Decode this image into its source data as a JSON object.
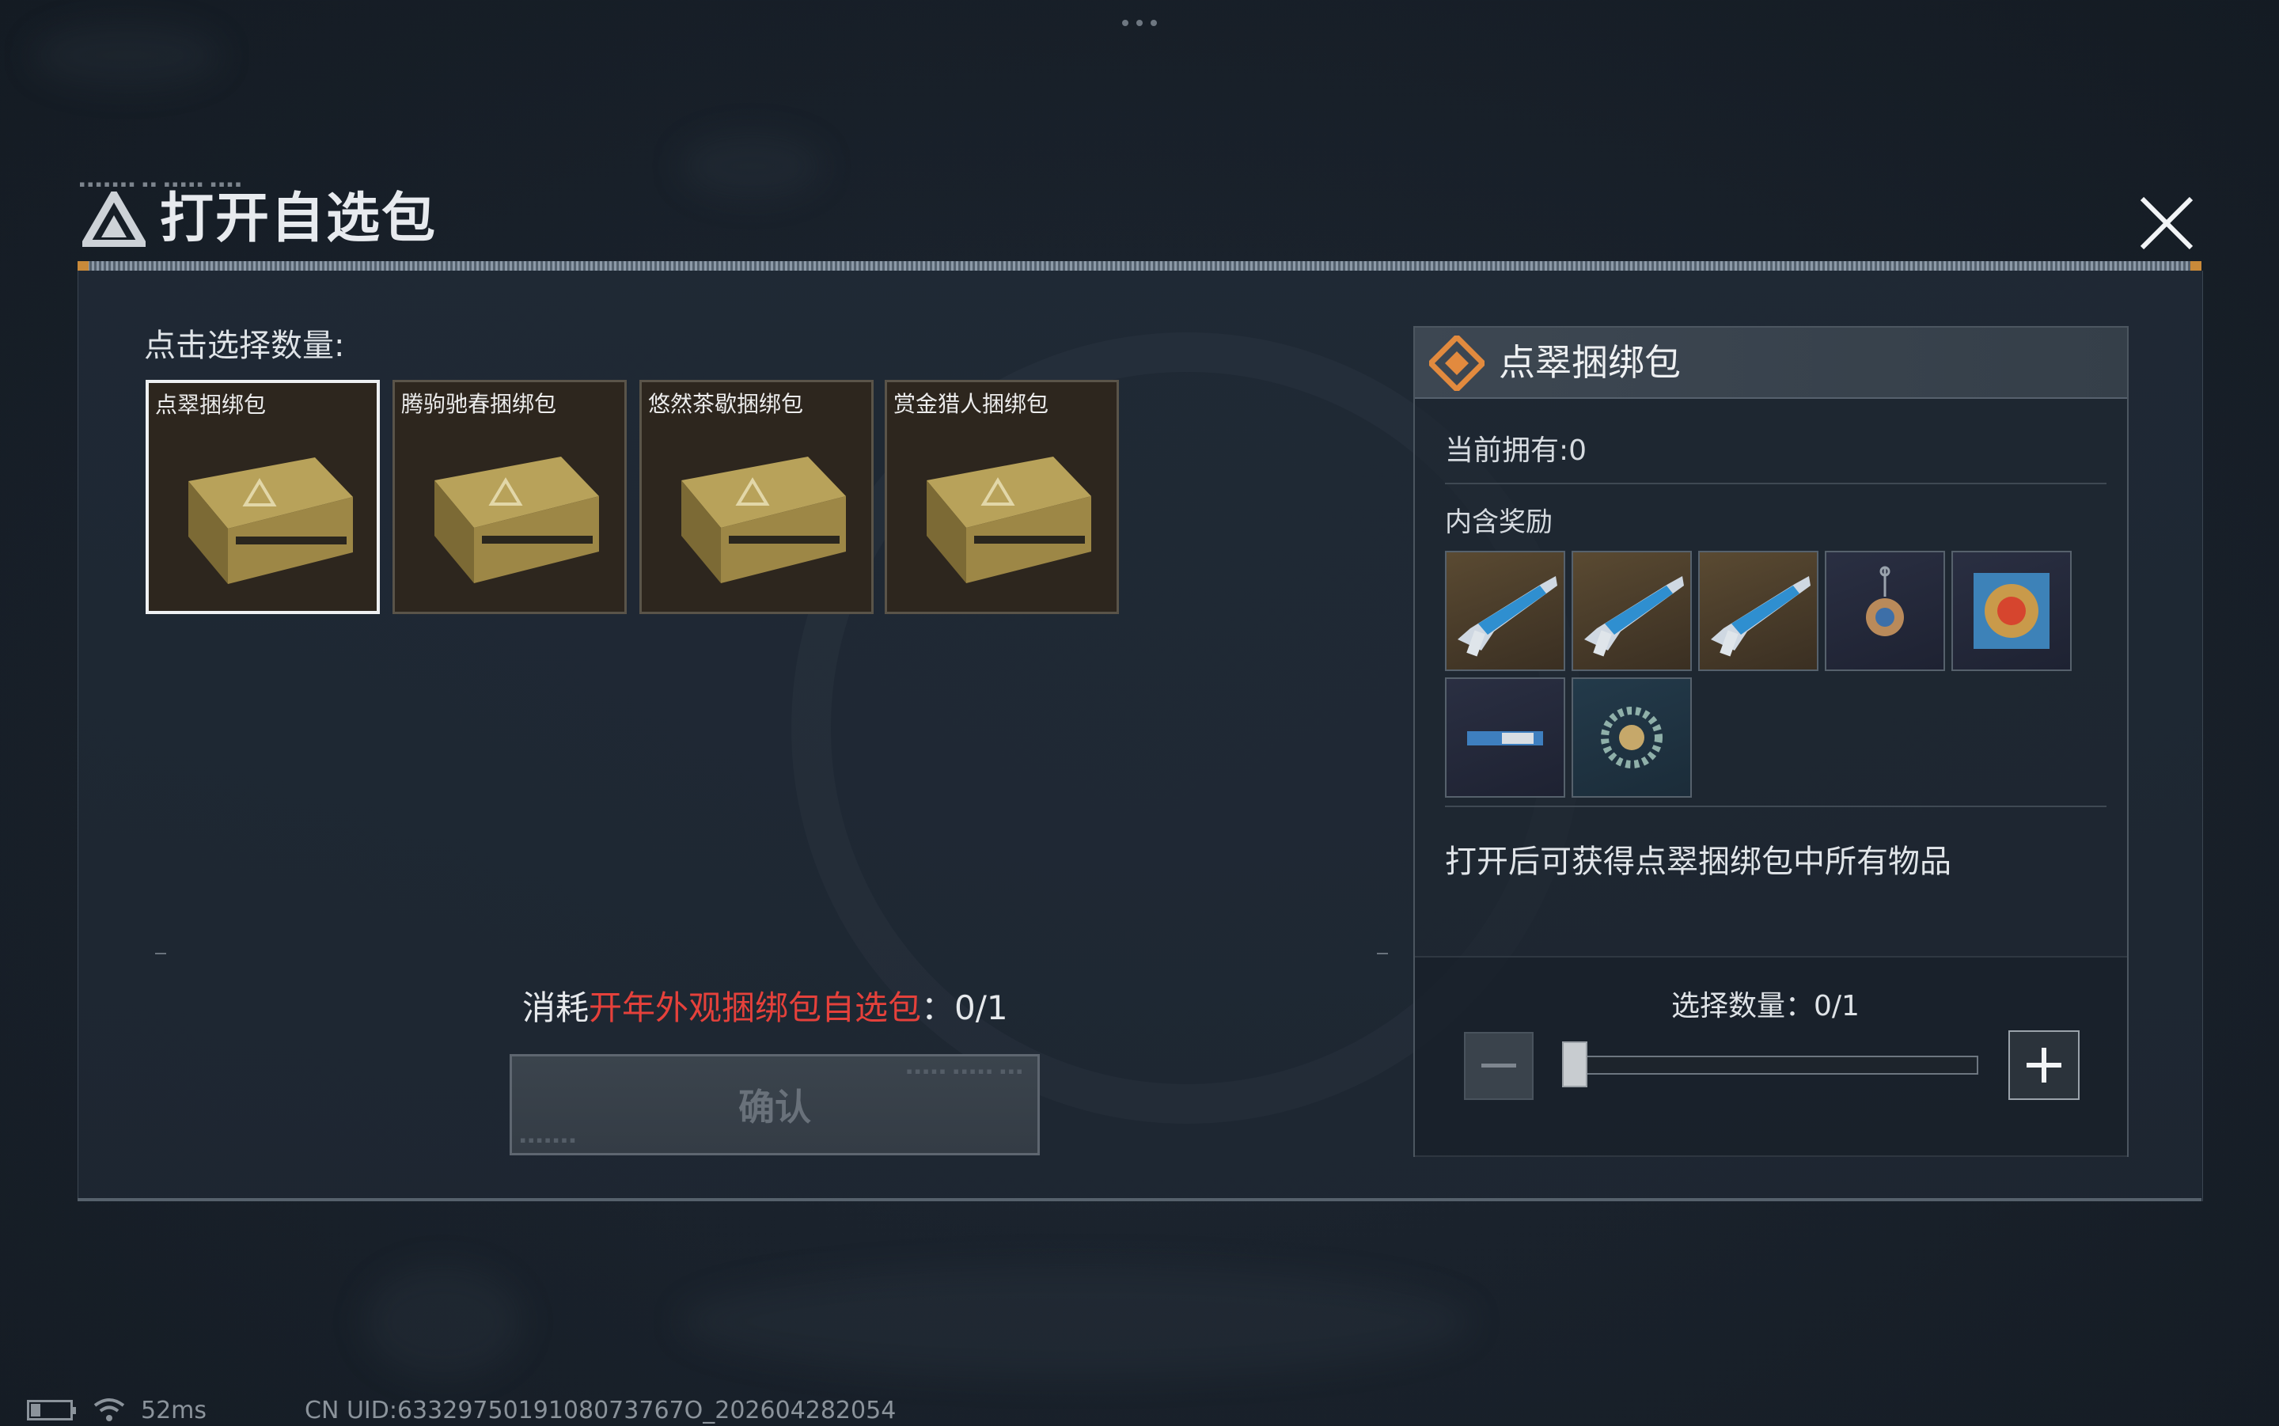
{
  "window": {
    "menu_dots_icon": "more-dots-icon"
  },
  "dialog": {
    "title": "打开自选包",
    "title_icon": "triangle-logo-icon",
    "close_icon": "close-icon"
  },
  "selection": {
    "label": "点击选择数量:",
    "packs": [
      {
        "name": "点翠捆绑包",
        "selected": true
      },
      {
        "name": "腾驹驰春捆绑包",
        "selected": false
      },
      {
        "name": "悠然茶歇捆绑包",
        "selected": false
      },
      {
        "name": "赏金猎人捆绑包",
        "selected": false
      }
    ]
  },
  "cost": {
    "prefix": "消耗",
    "item": "开年外观捆绑包自选包",
    "suffix": "：0/1",
    "accent_color": "#e5413b"
  },
  "confirm": {
    "label": "确认"
  },
  "detail": {
    "title": "点翠捆绑包",
    "icon": "orange-diamond-icon",
    "owned": "当前拥有:0",
    "rewards_label": "内含奖励",
    "rewards": [
      {
        "icon": "rifle-skin-icon",
        "rarity": "gold"
      },
      {
        "icon": "rifle-skin-icon",
        "rarity": "gold"
      },
      {
        "icon": "rifle-skin-icon",
        "rarity": "gold"
      },
      {
        "icon": "charm-pendant-icon",
        "rarity": "dark"
      },
      {
        "icon": "avatar-frame-icon",
        "rarity": "dark"
      },
      {
        "icon": "name-card-icon",
        "rarity": "dark"
      },
      {
        "icon": "emblem-icon",
        "rarity": "teal"
      }
    ],
    "description": "打开后可获得点翠捆绑包中所有物品",
    "quantity_label": "选择数量：0/1",
    "quantity_value": 0,
    "quantity_max": 1,
    "minus_icon": "minus-icon",
    "plus_icon": "plus-icon"
  },
  "status_bar": {
    "battery_level": 0.25,
    "wifi_icon": "wifi-icon",
    "ping": "52ms",
    "uid": "CN UID:6332975019108073767O_202604282054"
  }
}
